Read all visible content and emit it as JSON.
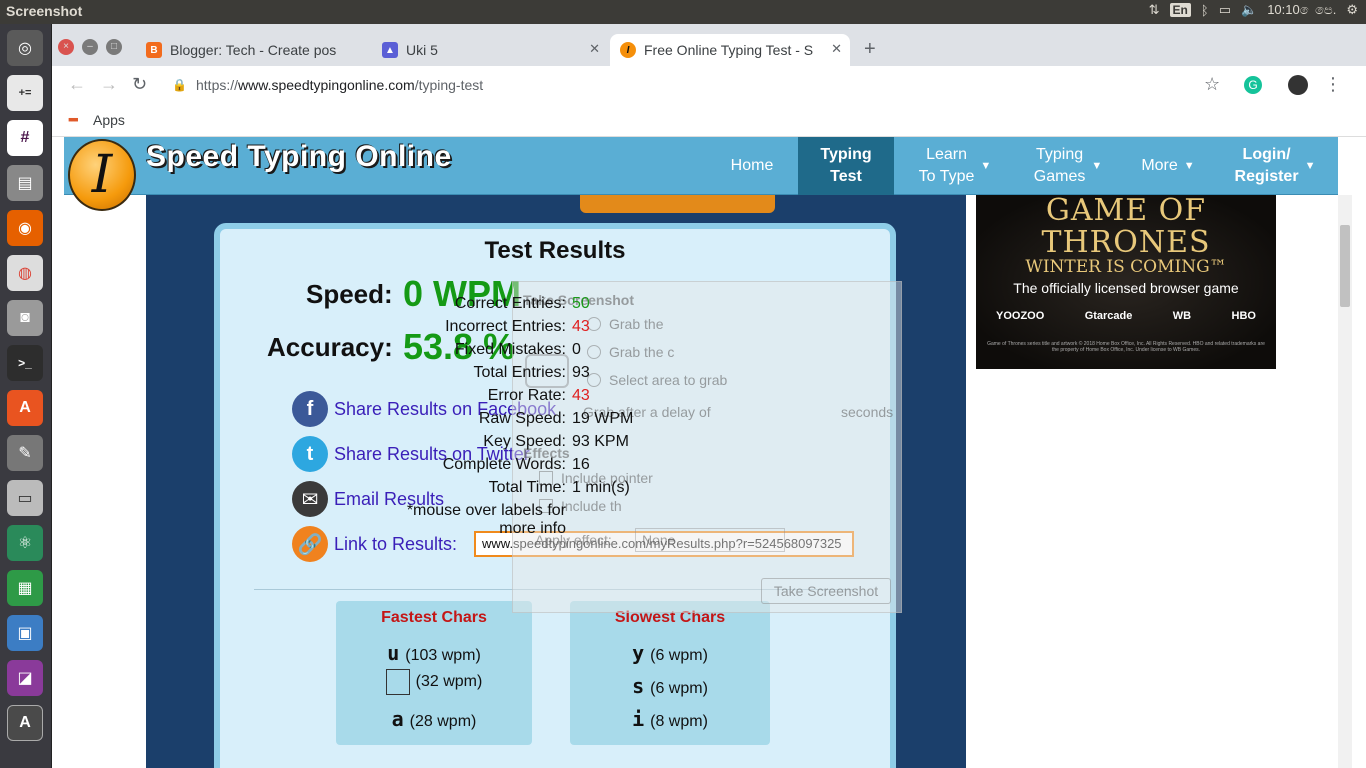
{
  "topbar": {
    "app_name": "Screenshot",
    "keyboard": "En",
    "time": "10:10 ෙපෙ."
  },
  "tabs": [
    {
      "title": "Blogger: Tech - Create pos",
      "icon_color": "#f26b1d",
      "icon": "blogger-icon"
    },
    {
      "title": "Uki 5",
      "icon_color": "#5b5fd6",
      "icon": "classroom-icon"
    },
    {
      "title": "Free Online Typing Test - S",
      "icon_color": "#f58f0a",
      "icon": "speedtyping-icon"
    }
  ],
  "toolbar": {
    "url_scheme": "https://",
    "url_host": "www.speedtypingonline.com",
    "url_path": "/typing-test"
  },
  "bookmarks": {
    "apps_label": "Apps"
  },
  "site": {
    "logo_letter": "I",
    "logo_text": "Speed Typing Online",
    "nav": [
      {
        "line1": "Home",
        "line2": ""
      },
      {
        "line1": "Typing",
        "line2": "Test"
      },
      {
        "line1": "Learn",
        "line2": "To Type"
      },
      {
        "line1": "Typing",
        "line2": "Games"
      },
      {
        "line1": "More",
        "line2": ""
      },
      {
        "line1": "Login/",
        "line2": "Register"
      }
    ]
  },
  "results": {
    "title": "Test Results",
    "speed_label": "Speed:",
    "speed_value": "0 WPM",
    "accuracy_label": "Accuracy:",
    "accuracy_value": "53.8 %",
    "share_facebook": "Share Results on Facebook",
    "share_twitter": "Share Results on Twitter",
    "email": "Email Results",
    "link_label": "Link to Results:",
    "link_url": "www.speedtypingonline.com/myResults.php?r=524568097325",
    "stats": [
      {
        "label": "Correct Entries:",
        "value": "50",
        "color": "green"
      },
      {
        "label": "Incorrect Entries:",
        "value": "43",
        "color": "red"
      },
      {
        "label": "Fixed Mistakes:",
        "value": "0",
        "color": ""
      },
      {
        "label": "Total Entries:",
        "value": "93",
        "color": ""
      },
      {
        "label": "Error Rate:",
        "value": "43",
        "color": "red"
      },
      {
        "label": "Raw Speed:",
        "value": "19 WPM",
        "color": ""
      },
      {
        "label": "Key Speed:",
        "value": "93 KPM",
        "color": ""
      },
      {
        "label": "Complete Words:",
        "value": "16",
        "color": ""
      },
      {
        "label": "Total Time:",
        "value": "1 min(s)",
        "color": ""
      }
    ],
    "mouse_note_1": "*mouse over labels for",
    "mouse_note_2": "more info",
    "fastest_title": "Fastest Chars",
    "fastest": [
      {
        "char": "u",
        "rate": "(103 wpm)"
      },
      {
        "char": "",
        "rate": "(32 wpm)"
      },
      {
        "char": "a",
        "rate": "(28 wpm)"
      }
    ],
    "slowest_title": "Slowest Chars",
    "slowest": [
      {
        "char": "y",
        "rate": "(6 wpm)"
      },
      {
        "char": "s",
        "rate": "(6 wpm)"
      },
      {
        "char": "i",
        "rate": "(8 wpm)"
      }
    ]
  },
  "screenshot_dialog": {
    "title": "Take Screenshot",
    "opt1": "Grab the",
    "opt2": "Grab the c",
    "opt3": "Select area to grab",
    "delay": "Grab after a delay of",
    "seconds": "seconds",
    "effects": "Effects",
    "include_pointer": "Include pointer",
    "include_border": "Include th",
    "apply_effect": "Apply effect:",
    "effect_value": "None",
    "take_button": "Take Screenshot"
  },
  "ad": {
    "title_1": "GAME OF",
    "title_2": "THRONES",
    "winter": "WINTER IS COMING™",
    "licensed": "The officially licensed browser game",
    "logo_1": "YOOZOO",
    "logo_2": "Gtarcade",
    "logo_3": "WB",
    "logo_4": "HBO",
    "fine_print": "Game of Thrones series title and artwork © 2018 Home Box Office, Inc. All Rights Reserved. HBO and related trademarks are the property of Home Box Office, Inc. Under license to WB Games."
  }
}
